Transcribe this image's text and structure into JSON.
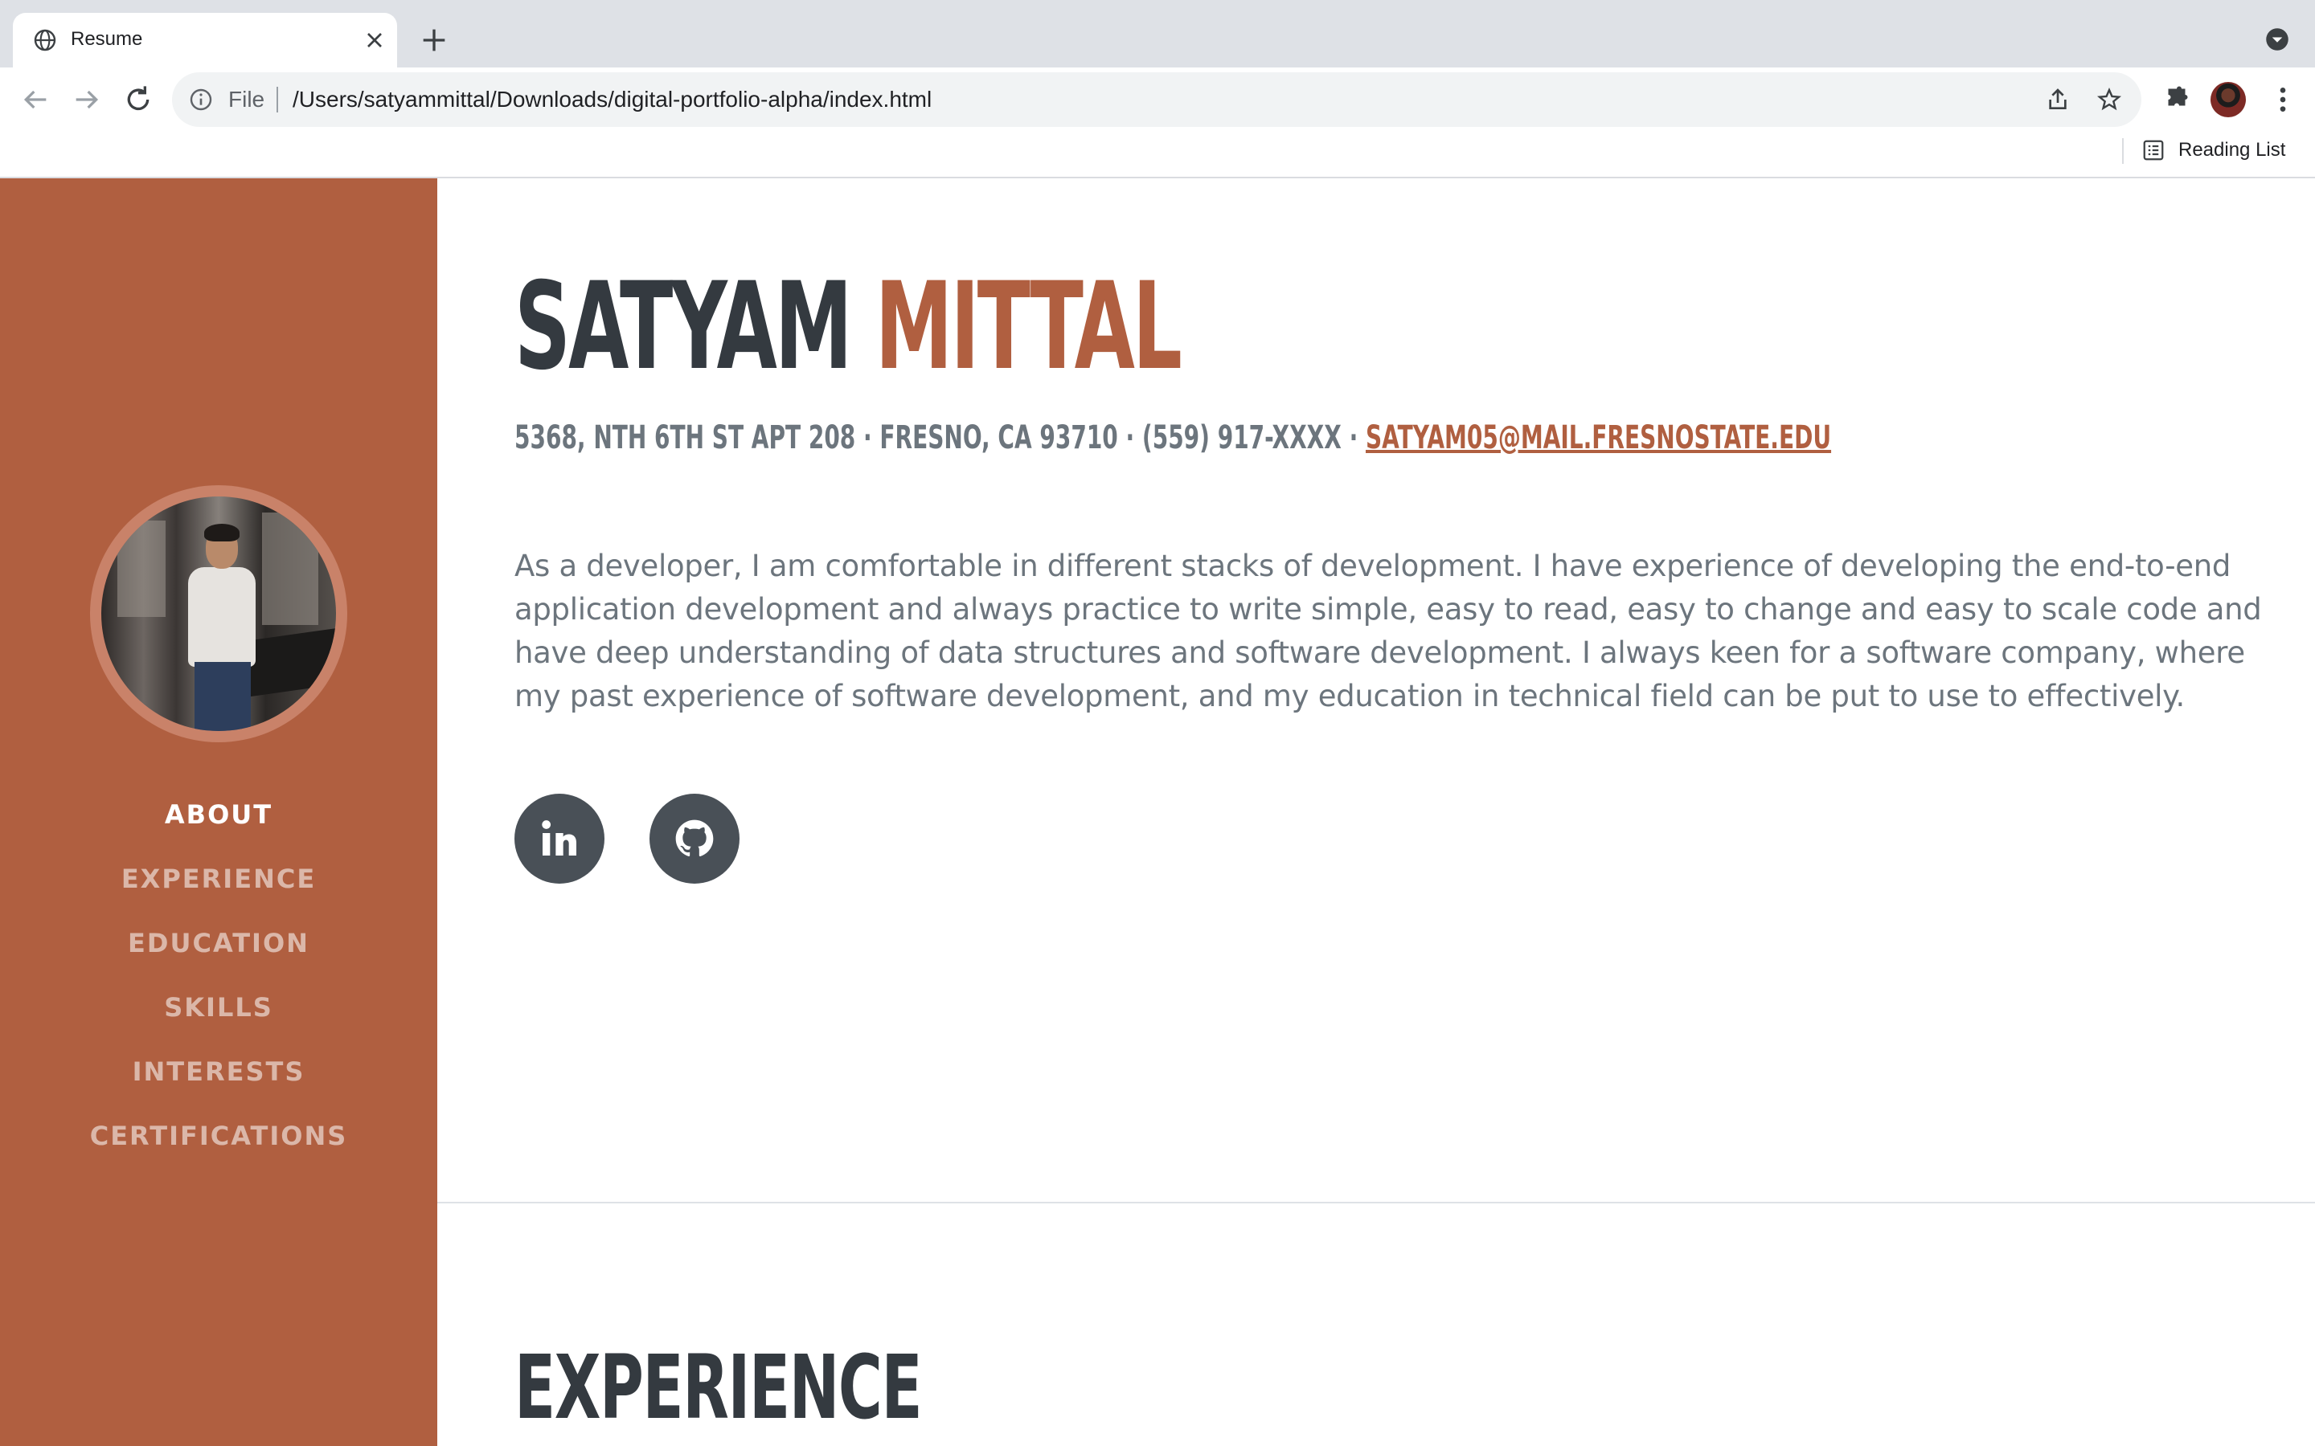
{
  "browser": {
    "tab": {
      "title": "Resume"
    },
    "address": {
      "scheme_label": "File",
      "url": "/Users/satyammittal/Downloads/digital-portfolio-alpha/index.html"
    },
    "bookmarks_bar": {
      "reading_list_label": "Reading List"
    }
  },
  "theme": {
    "accent": "#b05f40",
    "text_dark": "#343a40",
    "text_muted": "#6c757d",
    "icon_bg": "#495057"
  },
  "sidebar": {
    "nav": [
      {
        "label": "ABOUT",
        "active": true
      },
      {
        "label": "EXPERIENCE",
        "active": false
      },
      {
        "label": "EDUCATION",
        "active": false
      },
      {
        "label": "SKILLS",
        "active": false
      },
      {
        "label": "INTERESTS",
        "active": false
      },
      {
        "label": "CERTIFICATIONS",
        "active": false
      }
    ]
  },
  "about": {
    "first_name": "SATYAM",
    "last_name": "MITTAL",
    "contact": "5368, NTH 6TH ST APT 208 · FRESNO, CA 93710 · (559) 917-XXXX · ",
    "email": "SATYAM05@MAIL.FRESNOSTATE.EDU",
    "intro": "As a developer, I am comfortable in different stacks of development. I have experience of developing the end-to-end application development and always practice to write simple, easy to read, easy to change and easy to scale code and have deep understanding of data structures and software development. I always keen for a software company, where my past experience of software development, and my education in technical field can be put to use to effectively.",
    "social": [
      {
        "icon": "linkedin-icon"
      },
      {
        "icon": "github-icon"
      }
    ]
  },
  "experience": {
    "heading": "EXPERIENCE"
  }
}
